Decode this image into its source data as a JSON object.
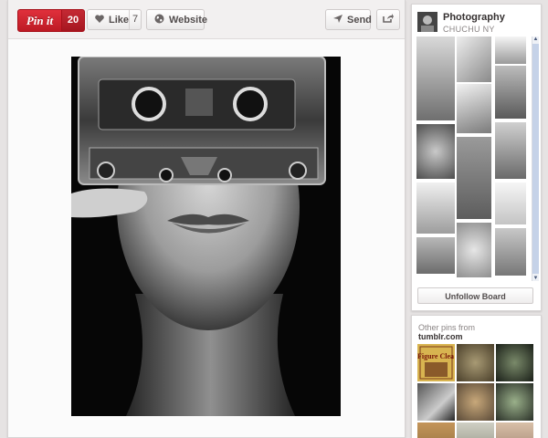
{
  "actions": {
    "pinit_label": "Pin it",
    "pinit_count": "20",
    "like_label": "Like",
    "like_count": "7",
    "website_label": "Website",
    "send_label": "Send"
  },
  "icons": {
    "like": "heart-icon",
    "website": "globe-icon",
    "send": "send-arrow-icon",
    "share": "share-icon"
  },
  "board": {
    "title": "Photography",
    "owner": "CHUCHU NY",
    "unfollow_label": "Unfollow Board"
  },
  "other_pins": {
    "heading": "Other pins from",
    "source": "tumblr.com",
    "thumb_caption": "Figure Clea"
  },
  "colors": {
    "pinit_red": "#cb2027",
    "background": "#e6e3e3"
  }
}
